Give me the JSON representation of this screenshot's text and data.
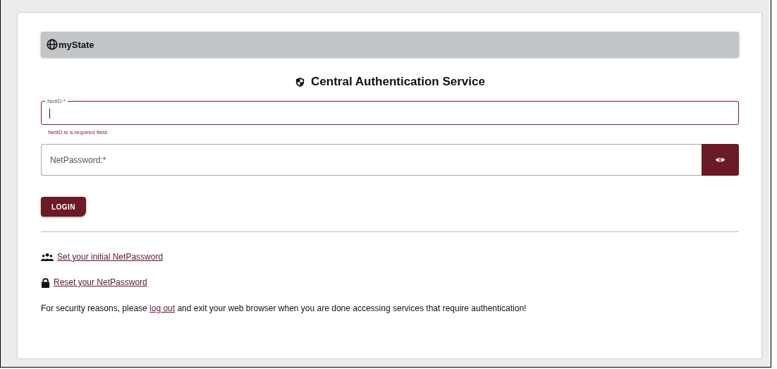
{
  "header": {
    "title": "myState"
  },
  "heading": "Central Authentication Service",
  "netid_field": {
    "label": "NetID:*",
    "error": true,
    "error_message": "NetID is a required field."
  },
  "password_field": {
    "placeholder": "NetPassword:*"
  },
  "login_button": "LOGIN",
  "links": [
    {
      "kind": "people",
      "label": "Set your initial NetPassword"
    },
    {
      "kind": "lock",
      "label": "Reset your NetPassword"
    }
  ],
  "notice": {
    "before": "For security reasons, please ",
    "link": "log out",
    "after": " and exit your web browser when you are done accessing services that require authentication!"
  }
}
